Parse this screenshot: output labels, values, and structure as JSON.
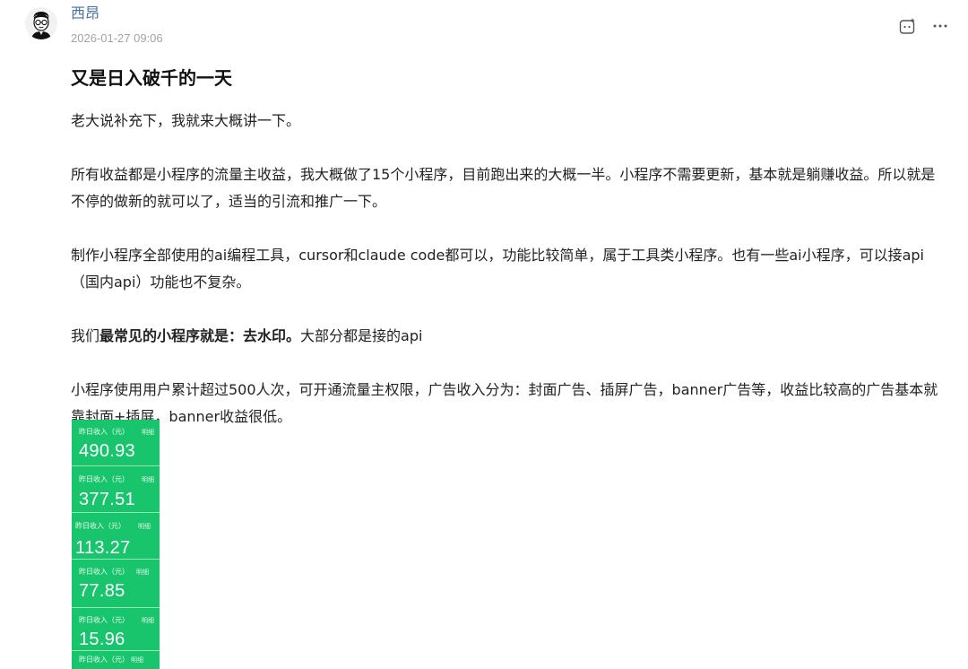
{
  "author": {
    "name": "西昂",
    "time": "2026-01-27 09:06",
    "avatar_icon": "cartoon-man-with-glasses-avatar"
  },
  "actions": {
    "ai_icon": "ai-robot-icon",
    "more_icon": "more-horizontal-icon"
  },
  "post": {
    "title": "又是日入破千的一天",
    "p1": "老大说补充下，我就来大概讲一下。",
    "p2": "所有收益都是小程序的流量主收益，我大概做了15个小程序，目前跑出来的大概一半。小程序不需要更新，基本就是躺赚收益。所以就是不停的做新的就可以了，适当的引流和推广一下。",
    "p3": "制作小程序全部使用的ai编程工具，cursor和claude code都可以，功能比较简单，属于工具类小程序。也有一些ai小程序，可以接api（国内api）功能也不复杂。",
    "p4_pre": "我们",
    "p4_bold": "最常见的小程序就是：去水印。",
    "p4_post": "大部分都是接的api",
    "p5": "小程序使用用户累计超过500人次，可开通流量主权限，广告收入分为：封面广告、插屏广告，banner广告等，收益比较高的广告基本就靠封面+插屏，banner收益很低。"
  },
  "revenue_cards": [
    {
      "label": "昨日收入（元）",
      "detail": "明细",
      "value": "490.93"
    },
    {
      "label": "昨日收入（元）",
      "detail": "明细",
      "value": "377.51"
    },
    {
      "label": "昨日收入（元）",
      "detail": "明细",
      "value": "113.27"
    },
    {
      "label": "昨日收入（元）",
      "detail": "明细",
      "value": "77.85"
    },
    {
      "label": "昨日收入（元）",
      "detail": "明细",
      "value": "15.96"
    },
    {
      "label": "昨日收入（元）",
      "detail": "明细",
      "value": ""
    }
  ],
  "colors": {
    "card_green": "#18c46c",
    "author_blue": "#4a6fa5"
  }
}
